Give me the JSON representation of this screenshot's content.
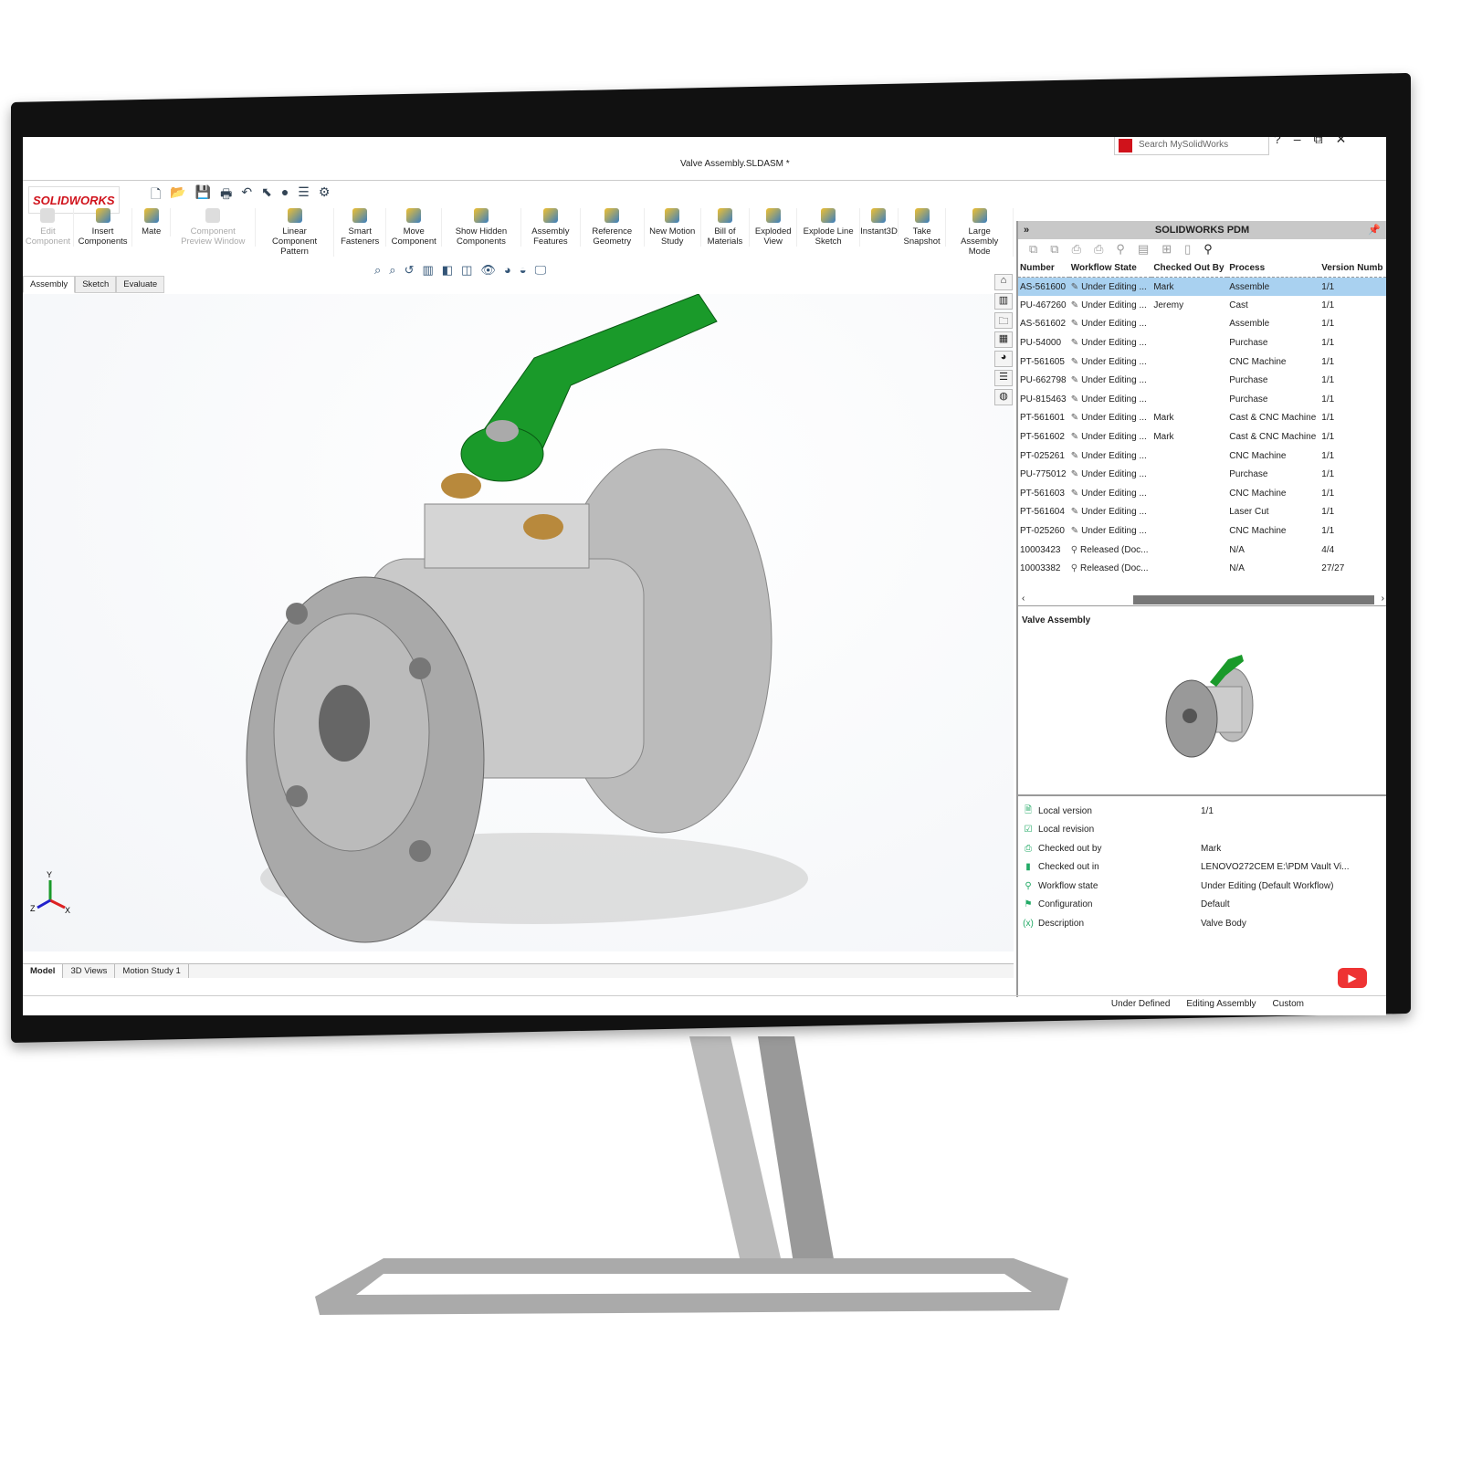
{
  "window": {
    "doc_title": "Valve Assembly.SLDASM *",
    "search_placeholder": "Search MySolidWorks",
    "help": "?",
    "minimize": "–",
    "restore": "⧉",
    "close": "✕"
  },
  "app": {
    "logo": "SOLIDWORKS"
  },
  "ribbon": [
    {
      "label": "Edit Component",
      "disabled": true
    },
    {
      "label": "Insert Components"
    },
    {
      "label": "Mate"
    },
    {
      "label": "Component Preview Window",
      "disabled": true
    },
    {
      "label": "Linear Component Pattern"
    },
    {
      "label": "Smart Fasteners"
    },
    {
      "label": "Move Component"
    },
    {
      "label": "Show Hidden Components"
    },
    {
      "label": "Assembly Features"
    },
    {
      "label": "Reference Geometry"
    },
    {
      "label": "New Motion Study"
    },
    {
      "label": "Bill of Materials"
    },
    {
      "label": "Exploded View"
    },
    {
      "label": "Explode Line Sketch"
    },
    {
      "label": "Instant3D"
    },
    {
      "label": "Take Snapshot"
    },
    {
      "label": "Large Assembly Mode"
    }
  ],
  "command_tabs": [
    "Assembly",
    "Sketch",
    "Evaluate"
  ],
  "bottom_tabs": [
    "Model",
    "3D Views",
    "Motion Study 1"
  ],
  "triad": {
    "x": "X",
    "y": "Y",
    "z": "Z"
  },
  "pdm": {
    "title": "SOLIDWORKS PDM",
    "expand": "»",
    "columns": [
      "Number",
      "Workflow State",
      "Checked Out By",
      "Process",
      "Version Numb"
    ],
    "rows": [
      [
        "AS-561600",
        "Under Editing ...",
        "Mark",
        "Assemble",
        "1/1"
      ],
      [
        "PU-467260",
        "Under Editing ...",
        "Jeremy",
        "Cast",
        "1/1"
      ],
      [
        "AS-561602",
        "Under Editing ...",
        "",
        "Assemble",
        "1/1"
      ],
      [
        "PU-54000",
        "Under Editing ...",
        "",
        "Purchase",
        "1/1"
      ],
      [
        "PT-561605",
        "Under Editing ...",
        "",
        "CNC Machine",
        "1/1"
      ],
      [
        "PU-662798",
        "Under Editing ...",
        "",
        "Purchase",
        "1/1"
      ],
      [
        "PU-815463",
        "Under Editing ...",
        "",
        "Purchase",
        "1/1"
      ],
      [
        "PT-561601",
        "Under Editing ...",
        "Mark",
        "Cast & CNC Machine",
        "1/1"
      ],
      [
        "PT-561602",
        "Under Editing ...",
        "Mark",
        "Cast & CNC Machine",
        "1/1"
      ],
      [
        "PT-025261",
        "Under Editing ...",
        "",
        "CNC Machine",
        "1/1"
      ],
      [
        "PU-775012",
        "Under Editing ...",
        "",
        "Purchase",
        "1/1"
      ],
      [
        "PT-561603",
        "Under Editing ...",
        "",
        "CNC Machine",
        "1/1"
      ],
      [
        "PT-561604",
        "Under Editing ...",
        "",
        "Laser Cut",
        "1/1"
      ],
      [
        "PT-025260",
        "Under Editing ...",
        "",
        "CNC Machine",
        "1/1"
      ],
      [
        "10003423",
        "Released (Doc...",
        "",
        "N/A",
        "4/4"
      ],
      [
        "10003382",
        "Released (Doc...",
        "",
        "N/A",
        "27/27"
      ]
    ],
    "preview_label": "Valve Assembly",
    "properties": [
      {
        "key": "Local version",
        "value": "1/1"
      },
      {
        "key": "Local revision",
        "value": ""
      },
      {
        "key": "Checked out by",
        "value": "Mark"
      },
      {
        "key": "Checked out in",
        "value": "LENOVO272CEM   E:\\PDM Vault Vi..."
      },
      {
        "key": "Workflow state",
        "value": "Under Editing (Default Workflow)"
      },
      {
        "key": "Configuration",
        "value": "Default"
      },
      {
        "key": "Description",
        "value": "Valve Body"
      }
    ]
  },
  "status": {
    "s1": "Under Defined",
    "s2": "Editing Assembly",
    "s3": "Custom"
  },
  "colors": {
    "brand": "#d0121b",
    "selection": "#a9d1f0",
    "handle": "#1a9a2a"
  }
}
